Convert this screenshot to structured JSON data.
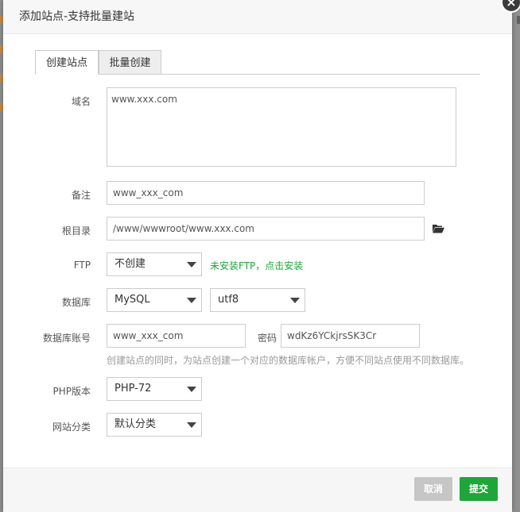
{
  "dialog": {
    "title": "添加站点-支持批量建站",
    "close_symbol": "×"
  },
  "tabs": [
    {
      "label": "创建站点",
      "active": true
    },
    {
      "label": "批量创建",
      "active": false
    }
  ],
  "form": {
    "domain": {
      "label": "域名",
      "value": "www.xxx.com"
    },
    "remark": {
      "label": "备注",
      "value": "www_xxx_com"
    },
    "root_dir": {
      "label": "根目录",
      "value": "/www/wwwroot/www.xxx.com",
      "icon": "folder-open-icon"
    },
    "ftp": {
      "label": "FTP",
      "selected": "不创建",
      "install_link": "未安装FTP，点击安装"
    },
    "database": {
      "label": "数据库",
      "type_selected": "MySQL",
      "charset_selected": "utf8"
    },
    "db_account": {
      "label": "数据库账号",
      "username": "www_xxx_com",
      "password_label": "密码",
      "password": "wdKz6YCkjrsSK3Cr",
      "hint": "创建站点的同时，为站点创建一个对应的数据库帐户，方便不同站点使用不同数据库。"
    },
    "php_version": {
      "label": "PHP版本",
      "selected": "PHP-72"
    },
    "site_category": {
      "label": "网站分类",
      "selected": "默认分类"
    }
  },
  "footer": {
    "cancel_label": "取消",
    "submit_label": "提交"
  },
  "colors": {
    "accent_green": "#20a53a",
    "cancel_gray": "#c6c6c6"
  }
}
